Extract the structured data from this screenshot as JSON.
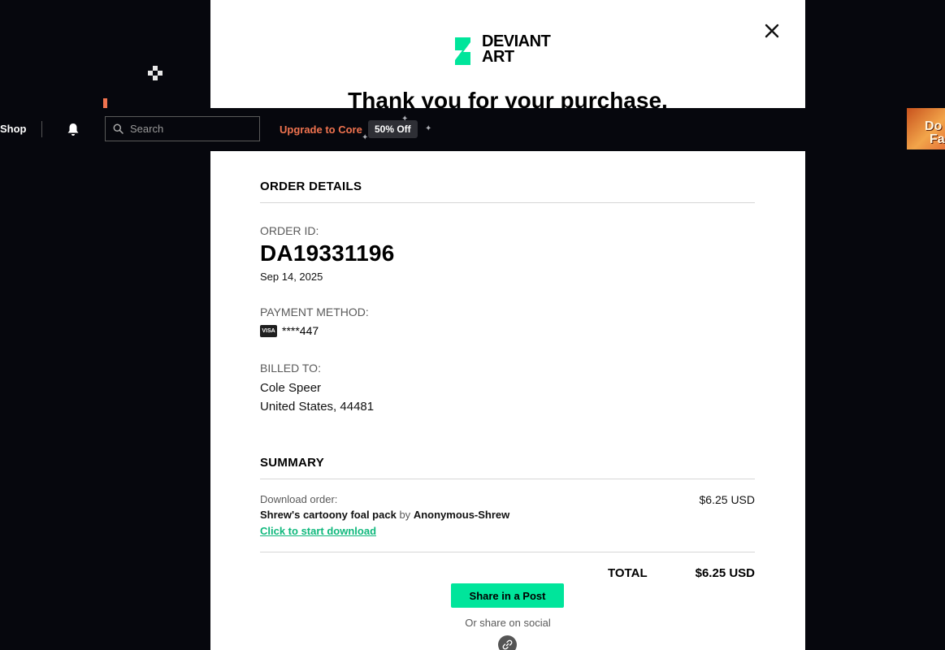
{
  "logo": {
    "line1": "DEVIANT",
    "line2": "ART"
  },
  "modal": {
    "thank_you": "Thank you for your purchase.",
    "order_details": {
      "heading": "ORDER DETAILS",
      "order_id_label": "ORDER ID:",
      "order_id": "DA19331196",
      "date": "Sep 14, 2025",
      "payment_label": "PAYMENT METHOD:",
      "card_brand": "VISA",
      "card_number": "****447",
      "billed_label": "BILLED TO:",
      "billed_name": "Cole Speer",
      "billed_location": "United States, 44481"
    },
    "summary": {
      "heading": "SUMMARY",
      "download_label": "Download order:",
      "item_name": "Shrew's cartoony foal pack",
      "by_text": "by",
      "author": "Anonymous-Shrew",
      "download_link": "Click to start download",
      "price": "$6.25 USD",
      "total_label": "TOTAL",
      "total_value": "$6.25 USD"
    },
    "share_button": "Share in a Post",
    "or_share": "Or share on social"
  },
  "topbar": {
    "shop": "Shop",
    "search_placeholder": "Search",
    "upgrade": "Upgrade to Core",
    "badge": "50% Off"
  },
  "ad": {
    "line1": "Do",
    "line2": "Fa"
  },
  "icons": {
    "close": "close-icon",
    "bell": "bell-icon",
    "search": "search-icon",
    "link": "link-icon",
    "logo": "deviantart-logo-icon"
  },
  "colors": {
    "accent_green": "#00e59b",
    "link_green": "#0fb87c",
    "upgrade_orange": "#f0734f",
    "background": "#06070d"
  }
}
